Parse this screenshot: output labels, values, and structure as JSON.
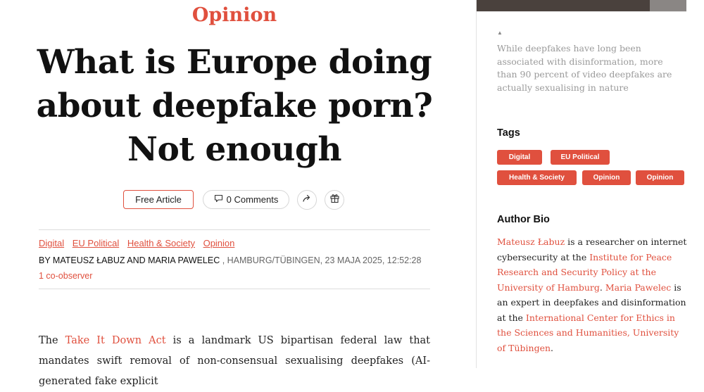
{
  "article": {
    "category": "Opinion",
    "headline": "What is Europe doing about deepfake porn? Not enough",
    "actions": {
      "free_article": "Free Article",
      "comments": "0 Comments",
      "share_icon": "share-icon",
      "gift_icon": "gift-icon",
      "comment_icon": "comment-icon"
    },
    "tags": [
      "Digital",
      "EU Political",
      "Health & Society",
      "Opinion"
    ],
    "byline": {
      "authors": "BY MATEUSZ ŁABUZ AND MARIA PAWELEC",
      "location_date": " , HAMBURG/TÜBINGEN, 23 MAJA 2025, 12:52:28"
    },
    "co_observer": "1 co-observer",
    "body": {
      "p1_start": "The ",
      "p1_link": "Take It Down Act",
      "p1_rest": " is a landmark US bipartisan federal law that mandates swift removal of non-consensual sexualising deepfakes (AI-generated fake explicit"
    }
  },
  "sidebar": {
    "caption": "While deepfakes have long been associated with disinformation, more than 90 percent of video deepfakes are actually sexualising in nature",
    "tags_heading": "Tags",
    "tags": [
      "Digital",
      "EU Political",
      "Health & Society",
      "Opinion",
      "Opinion"
    ],
    "bio_heading": "Author Bio",
    "bio": {
      "author1": "Mateusz Łabuz",
      "t1": " is a researcher on internet cybersecurity at the ",
      "inst1": "Institute for Peace Research and Security Policy at the University of Hamburg",
      "t2": ". ",
      "author2": "Maria Pawelec",
      "t3": " is an expert in deepfakes and disinformation at the ",
      "inst2": "International Center for Ethics in the Sciences and Humanities, University of Tübingen",
      "t4": "."
    }
  },
  "colors": {
    "accent": "#e0503e",
    "text": "#111111",
    "muted": "#9a9a9a"
  }
}
